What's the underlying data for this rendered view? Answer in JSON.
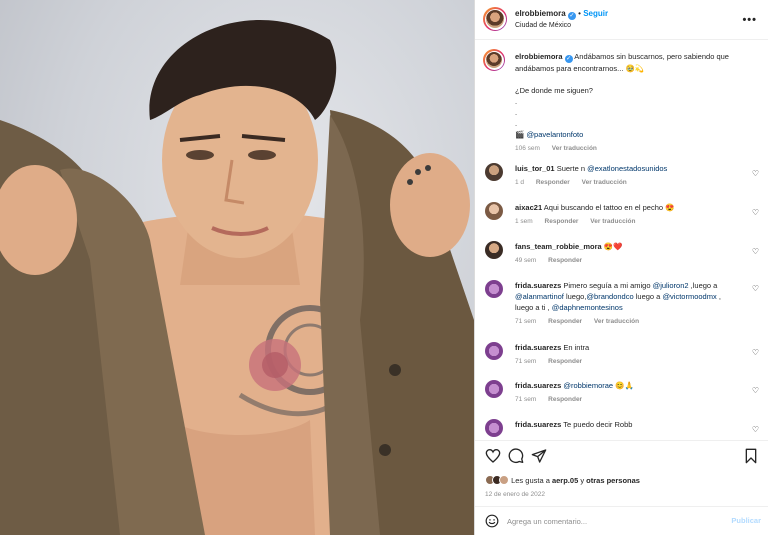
{
  "post": {
    "author": "elrobbiemora",
    "verified": true,
    "follow_label": "Seguir",
    "dot": "•",
    "location": "Ciudad de México",
    "more_icon": "more-horizontal-icon"
  },
  "caption": {
    "author": "elrobbiemora",
    "line1": "Andábamos sin buscarnos, pero sabiendo que andábamos para encontrarnos... 🥹💫",
    "line2": "¿De donde me siguen?",
    "dot1": ".",
    "dot2": ".",
    "dot3": ".",
    "credit_icon": "🎬",
    "credit": "@pavelantonfoto",
    "time": "106 sem",
    "translate": "Ver traducción"
  },
  "comments": [
    {
      "user": "luis_tor_01",
      "prefix": "Suerte n ",
      "mention": "@exatlonestadosunidos",
      "rest": "",
      "time": "1 d",
      "reply": "Responder",
      "translate": "Ver traducción"
    },
    {
      "user": "aixac21",
      "prefix": "Aqui buscando el tattoo en el pecho 😍",
      "mention": "",
      "rest": "",
      "time": "1 sem",
      "reply": "Responder",
      "translate": "Ver traducción"
    },
    {
      "user": "fans_team_robbie_mora",
      "prefix": "😍❤️",
      "mention": "",
      "rest": "",
      "time": "49 sem",
      "reply": "Responder",
      "translate": ""
    },
    {
      "user": "frida.suarezs",
      "prefix": "Pimero seguía a mi amigo ",
      "mention": "@julioron2",
      "rest": " ,luego a",
      "line2a": "@alanmartinof",
      "line2b": " luego,",
      "line2c": "@brandondco",
      "line2d": " luego a ",
      "line2e": "@victormoodmx",
      "line2f": " ,",
      "line3a": "luego a ti , ",
      "line3b": "@daphnemontesinos",
      "time": "71 sem",
      "reply": "Responder",
      "translate": "Ver traducción"
    },
    {
      "user": "frida.suarezs",
      "prefix": "En intra",
      "mention": "",
      "rest": "",
      "time": "71 sem",
      "reply": "Responder",
      "translate": ""
    },
    {
      "user": "frida.suarezs",
      "prefix": "",
      "mention": "@robbiemorae",
      "rest": " 😊🙏",
      "time": "71 sem",
      "reply": "Responder",
      "translate": ""
    },
    {
      "user": "frida.suarezs",
      "prefix": "Te puedo decir Robb",
      "mention": "",
      "rest": "",
      "time": "",
      "reply": "",
      "translate": ""
    }
  ],
  "actions": {
    "like_icon": "heart-icon",
    "comment_icon": "comment-icon",
    "share_icon": "share-icon",
    "save_icon": "bookmark-icon",
    "likes_prefix": "Les gusta a ",
    "likes_user": "aerp.05",
    "likes_mid": " y ",
    "likes_others": "otras personas",
    "date": "12 de enero de 2022"
  },
  "composer": {
    "emoji_icon": "smile-icon",
    "placeholder": "Agrega un comentario...",
    "publish": "Publicar"
  },
  "colors": {
    "accent": "#0095f6",
    "verified": "#3897f0",
    "muted": "#8e8e8e",
    "mention": "#00376b"
  }
}
